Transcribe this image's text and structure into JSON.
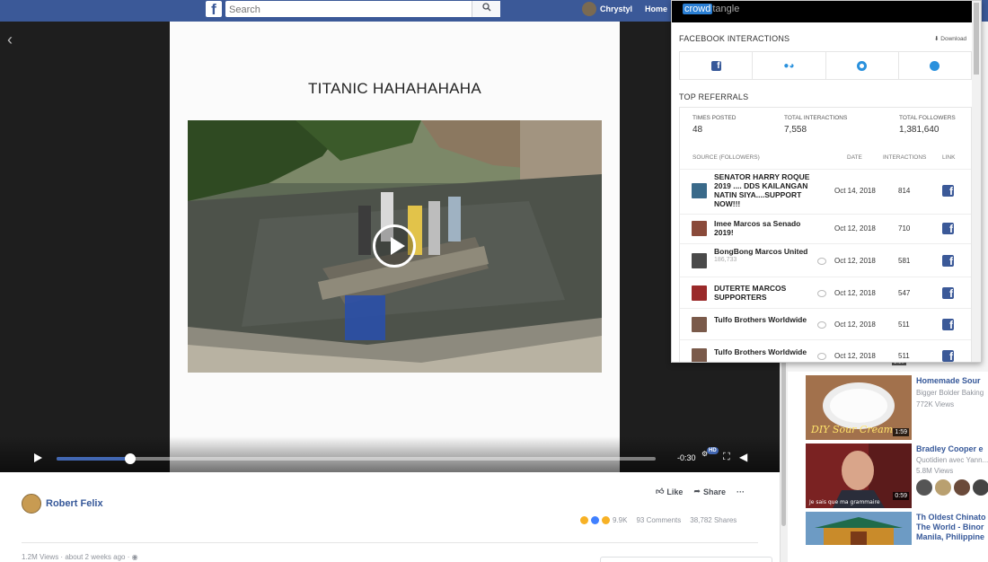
{
  "header": {
    "search_placeholder": "Search",
    "user_name": "Chrystyl",
    "home_label": "Home"
  },
  "video": {
    "slide_title": "TITANIC HAHAHAHAHA",
    "time_remaining": "-0:30",
    "quality_badge": "HD",
    "progress_fraction": 0.123
  },
  "post": {
    "author": "Robert Felix",
    "like_label": "Like",
    "share_label": "Share",
    "more_label": "···",
    "reactions_count": "9.9K",
    "comments": "93 Comments",
    "shares": "38,782 Shares",
    "views_meta": "1.2M Views · about 2 weeks ago ·",
    "reaction_colors": [
      "#f7b125",
      "#4080ff",
      "#f7b125"
    ]
  },
  "crowdtangle": {
    "logo_highlight": "crowd",
    "logo_rest": "tangle",
    "fb_interactions_title": "FACEBOOK INTERACTIONS",
    "download_label": "Download",
    "top_referrals_title": "TOP REFERRALS",
    "stats": {
      "times_posted_label": "TIMES POSTED",
      "times_posted": "48",
      "total_interactions_label": "TOTAL INTERACTIONS",
      "total_interactions": "7,558",
      "total_followers_label": "TOTAL FOLLOWERS",
      "total_followers": "1,381,640"
    },
    "columns": {
      "source": "SOURCE (FOLLOWERS)",
      "date": "DATE",
      "interactions": "INTERACTIONS",
      "link": "LINK"
    },
    "rows": [
      {
        "name": "SENATOR HARRY ROQUE 2019 .... DDS KAILANGAN NATIN SIYA....SUPPORT NOW!!!",
        "followers": "",
        "date": "Oct 14, 2018",
        "interactions": "814",
        "comment_icon": false
      },
      {
        "name": "Imee Marcos sa Senado 2019!",
        "followers": "",
        "date": "Oct 12, 2018",
        "interactions": "710",
        "comment_icon": false
      },
      {
        "name": "BongBong Marcos United",
        "followers": "186,733",
        "date": "Oct 12, 2018",
        "interactions": "581",
        "comment_icon": true
      },
      {
        "name": "DUTERTE MARCOS SUPPORTERS",
        "followers": "",
        "date": "Oct 12, 2018",
        "interactions": "547",
        "comment_icon": true
      },
      {
        "name": "Tulfo Brothers Worldwide",
        "followers": "",
        "date": "Oct 12, 2018",
        "interactions": "511",
        "comment_icon": true
      },
      {
        "name": "Tulfo Brothers Worldwide",
        "followers": "",
        "date": "Oct 12, 2018",
        "interactions": "511",
        "comment_icon": true
      }
    ]
  },
  "suggested": [
    {
      "title": "Homemade Sour",
      "sub1": "Bigger Bolder Baking",
      "sub2": "772K Views",
      "duration": "1:59",
      "overlay": "DIY Sour Cream"
    },
    {
      "title": "Bradley Cooper e",
      "sub1": "Quotidien avec Yann...",
      "sub2": "5.8M Views",
      "duration": "0:59",
      "overlay": "Je sais que ma grammaire"
    },
    {
      "title": "Th Oldest Chinato",
      "title2": "The World - Binor",
      "title3": "Manila, Philippine",
      "duration": ""
    }
  ],
  "suggested_top_duration": "1:10"
}
